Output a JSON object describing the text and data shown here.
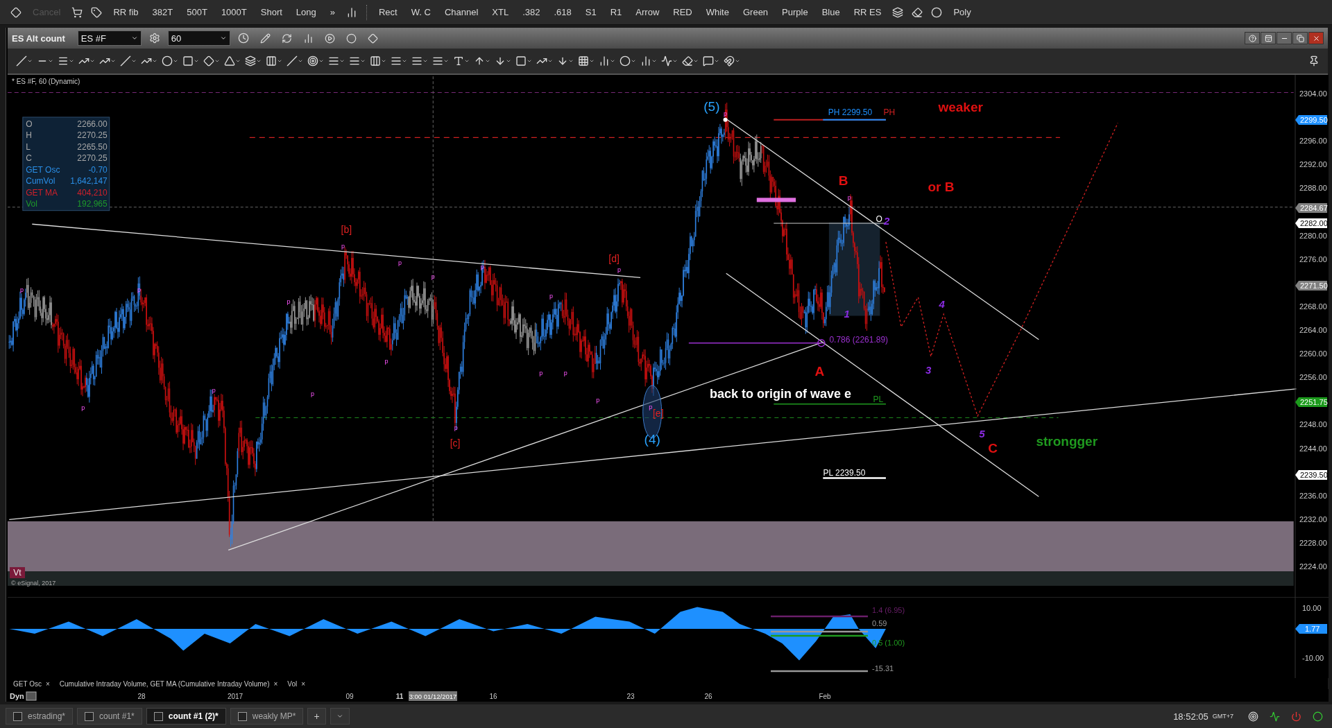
{
  "toolbar": {
    "buttons": [
      {
        "label": "Cancel",
        "disabled": true
      },
      {
        "label": "RR fib",
        "disabled": false
      },
      {
        "label": "382T",
        "disabled": false
      },
      {
        "label": "500T",
        "disabled": false
      },
      {
        "label": "1000T",
        "disabled": false
      },
      {
        "label": "Short",
        "disabled": false
      },
      {
        "label": "Long",
        "disabled": false
      },
      {
        "label": "»",
        "disabled": false
      },
      {
        "label": "Rect",
        "disabled": false
      },
      {
        "label": "W. C",
        "disabled": false
      },
      {
        "label": "Channel",
        "disabled": false
      },
      {
        "label": "XTL",
        "disabled": false
      },
      {
        "label": ".382",
        "disabled": false
      },
      {
        "label": ".618",
        "disabled": false
      },
      {
        "label": "S1",
        "disabled": false
      },
      {
        "label": "R1",
        "disabled": false
      },
      {
        "label": "Arrow",
        "disabled": false
      },
      {
        "label": "RED",
        "disabled": false
      },
      {
        "label": "White",
        "disabled": false
      },
      {
        "label": "Green",
        "disabled": false
      },
      {
        "label": "Purple",
        "disabled": false
      },
      {
        "label": "Blue",
        "disabled": false
      },
      {
        "label": "RR ES",
        "disabled": false
      },
      {
        "label": "Poly",
        "disabled": false
      }
    ]
  },
  "window": {
    "title": "ES Alt count",
    "symbol": "ES #F",
    "interval": "60"
  },
  "chart": {
    "legend": "* ES #F, 60 (Dynamic)",
    "data_window": [
      {
        "label": "O",
        "value": "2266.00",
        "color": "#a8a8a8"
      },
      {
        "label": "H",
        "value": "2270.25",
        "color": "#a8a8a8"
      },
      {
        "label": "L",
        "value": "2265.50",
        "color": "#a8a8a8"
      },
      {
        "label": "C",
        "value": "2270.25",
        "color": "#a8a8a8"
      },
      {
        "label": "GET Osc",
        "value": "-0.70",
        "color": "#2a8fe8"
      },
      {
        "label": "CumVol",
        "value": "1,642,147",
        "color": "#2a8fe8"
      },
      {
        "label": "GET MA",
        "value": "404,210",
        "color": "#d0202a"
      },
      {
        "label": "Vol",
        "value": "192,965",
        "color": "#1e9a2a"
      }
    ],
    "price_axis": [
      "2304.00",
      "2296.00",
      "2292.00",
      "2288.00",
      "2280.00",
      "2276.00",
      "2268.00",
      "2264.00",
      "2260.00",
      "2256.00",
      "2248.00",
      "2244.00",
      "2236.00",
      "2232.00",
      "2228.00",
      "2224.00"
    ],
    "price_markers": [
      {
        "value": "2299.50",
        "color": "#1e90ff"
      },
      {
        "value": "2284.67",
        "color": "#808080"
      },
      {
        "value": "2282.00",
        "color": "#ffffff"
      },
      {
        "value": "2271.50",
        "color": "#808080"
      },
      {
        "value": "2251.75",
        "color": "#1c9a1c"
      },
      {
        "value": "2239.50",
        "color": "#ffffff"
      }
    ],
    "annotations": [
      {
        "text": "(5)",
        "kind": "wave",
        "color": "#29a3ff"
      },
      {
        "text": "PH 2299.50",
        "kind": "level",
        "color": "#1e90ff"
      },
      {
        "text": "PH",
        "kind": "level",
        "color": "#d02020"
      },
      {
        "text": "weaker",
        "kind": "label",
        "color": "#e01010"
      },
      {
        "text": "B",
        "kind": "label",
        "color": "#e01010"
      },
      {
        "text": "or B",
        "kind": "label",
        "color": "#e01010"
      },
      {
        "text": "O",
        "kind": "level",
        "color": "#ffffff"
      },
      {
        "text": "2",
        "kind": "count",
        "color": "#8a2be2"
      },
      {
        "text": "[b]",
        "kind": "subwave",
        "color": "#e02020"
      },
      {
        "text": "[d]",
        "kind": "subwave",
        "color": "#e02020"
      },
      {
        "text": "4",
        "kind": "count",
        "color": "#8a2be2"
      },
      {
        "text": "1",
        "kind": "count",
        "color": "#8a2be2"
      },
      {
        "text": "0.786 (2261.89)",
        "kind": "level",
        "color": "#9b30d0"
      },
      {
        "text": "A",
        "kind": "label",
        "color": "#e01010"
      },
      {
        "text": "3",
        "kind": "count",
        "color": "#8a2be2"
      },
      {
        "text": "back to origin of wave e",
        "kind": "note",
        "color": "#ffffff"
      },
      {
        "text": "PL",
        "kind": "level",
        "color": "#1f9a1f"
      },
      {
        "text": "[e]",
        "kind": "subwave",
        "color": "#e02020"
      },
      {
        "text": "[c]",
        "kind": "subwave",
        "color": "#e02020"
      },
      {
        "text": "(4)",
        "kind": "wave",
        "color": "#29a3ff"
      },
      {
        "text": "5",
        "kind": "count",
        "color": "#8a2be2"
      },
      {
        "text": "C",
        "kind": "label",
        "color": "#e01010"
      },
      {
        "text": "strongger",
        "kind": "label",
        "color": "#1f9a1f"
      },
      {
        "text": "PL 2239.50",
        "kind": "level",
        "color": "#ffffff"
      }
    ],
    "pivot_labels": [
      "p",
      "p",
      "p",
      "p",
      "p",
      "p",
      "p",
      "p",
      "p",
      "p",
      "p",
      "p",
      "p",
      "p",
      "p",
      "p",
      "p",
      "p",
      "p",
      "p"
    ],
    "badge": "Vt",
    "copyright": "© eSignal, 2017"
  },
  "oscillator": {
    "levels": [
      {
        "text": "1.4 (6.95)",
        "color": "#6a1f6a"
      },
      {
        "text": "0.59",
        "color": "#9a9a9a"
      },
      {
        "text": "0.5 (1.00)",
        "color": "#1f9a1f"
      },
      {
        "text": "-15.31",
        "color": "#9a9a9a"
      }
    ],
    "axis": [
      "10.00",
      "-10.00"
    ],
    "marker": "1.77"
  },
  "indicators": [
    {
      "label": "GET Osc",
      "close": "×"
    },
    {
      "label": "Cumulative Intraday Volume, GET MA (Cumulative Intraday Volume)",
      "close": "×"
    },
    {
      "label": "Vol",
      "close": "×"
    }
  ],
  "time_axis": {
    "mode": "Dyn",
    "labels": [
      "28",
      "2017",
      "09",
      "11",
      "16",
      "23",
      "26",
      "Feb"
    ],
    "crosshair": "3:00 01/12/2017"
  },
  "taskbar": {
    "tabs": [
      {
        "label": "estrading*",
        "selected": false
      },
      {
        "label": "count #1*",
        "selected": false
      },
      {
        "label": "count #1 (2)*",
        "selected": true
      },
      {
        "label": "weakly MP*",
        "selected": false
      }
    ],
    "add": "+",
    "time": "18:52:05",
    "timezone": "GMT+7"
  }
}
